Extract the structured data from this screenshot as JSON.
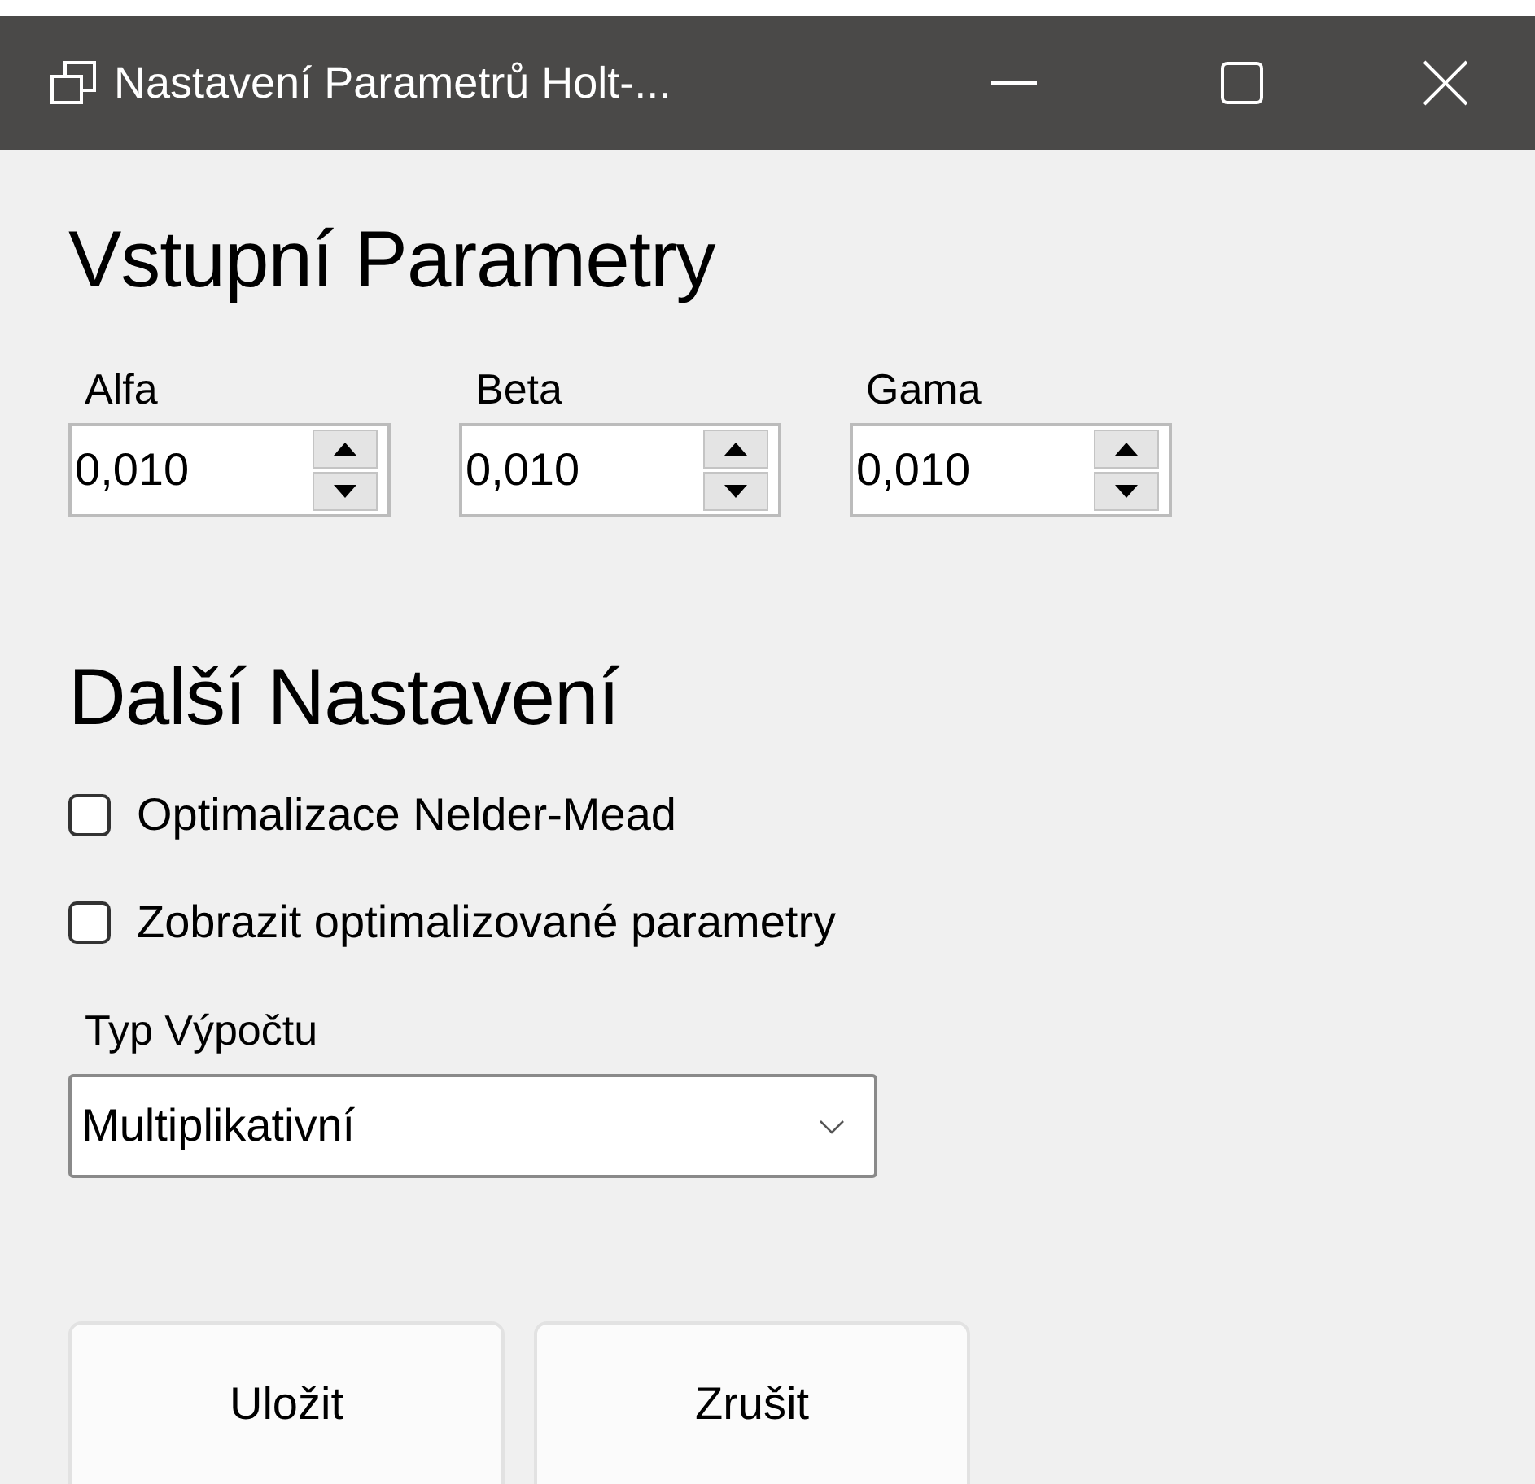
{
  "window": {
    "title": "Nastavení Parametrů Holt-..."
  },
  "input_section": {
    "heading": "Vstupní Parametry",
    "fields": [
      {
        "label": "Alfa",
        "value": "0,010"
      },
      {
        "label": "Beta",
        "value": "0,010"
      },
      {
        "label": "Gama",
        "value": "0,010"
      }
    ]
  },
  "settings_section": {
    "heading": "Další Nastavení",
    "checkboxes": [
      {
        "label": "Optimalizace Nelder-Mead",
        "checked": false
      },
      {
        "label": "Zobrazit optimalizované parametry",
        "checked": false
      }
    ],
    "calc_type": {
      "label": "Typ Výpočtu",
      "value": "Multiplikativní"
    }
  },
  "buttons": [
    "Uložit",
    "Zrušit"
  ]
}
